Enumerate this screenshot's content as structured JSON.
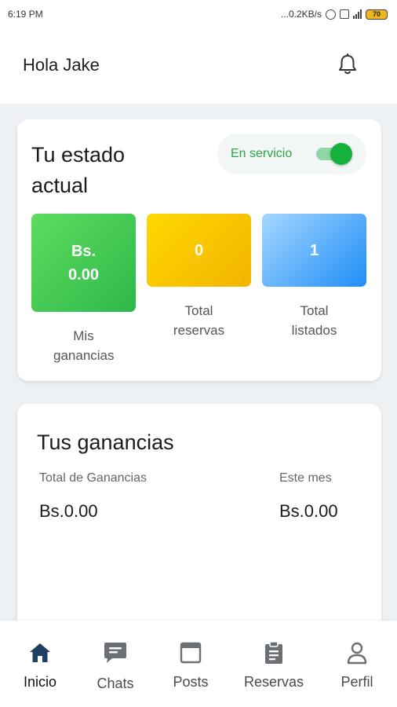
{
  "statusbar": {
    "time": "6:19 PM",
    "network_speed": "...0.2KB/s",
    "battery": "70"
  },
  "header": {
    "greeting": "Hola Jake",
    "bell_icon": "bell-icon"
  },
  "status_card": {
    "title": "Tu estado actual",
    "toggle": {
      "label": "En servicio",
      "on": true,
      "color": "#16b03d"
    },
    "stats": [
      {
        "value": "Bs. 0.00",
        "label": "Mis ganancias",
        "color": "#3cc853"
      },
      {
        "value": "0",
        "label": "Total reservas",
        "color": "#f5c200"
      },
      {
        "value": "1",
        "label": "Total listados",
        "color": "#4aa8fb"
      }
    ]
  },
  "earnings_card": {
    "title": "Tus ganancias",
    "total_label": "Total de Ganancias",
    "total_value": "Bs.0.00",
    "month_label": "Este mes",
    "month_value": "Bs.0.00"
  },
  "bottom_nav": {
    "items": [
      {
        "label": "Inicio",
        "icon": "home-icon",
        "active": true
      },
      {
        "label": "Chats",
        "icon": "chat-icon",
        "active": false
      },
      {
        "label": "Posts",
        "icon": "posts-icon",
        "active": false
      },
      {
        "label": "Reservas",
        "icon": "clipboard-icon",
        "active": false
      },
      {
        "label": "Perfil",
        "icon": "profile-icon",
        "active": false
      }
    ],
    "active_color": "#1f3f63"
  }
}
